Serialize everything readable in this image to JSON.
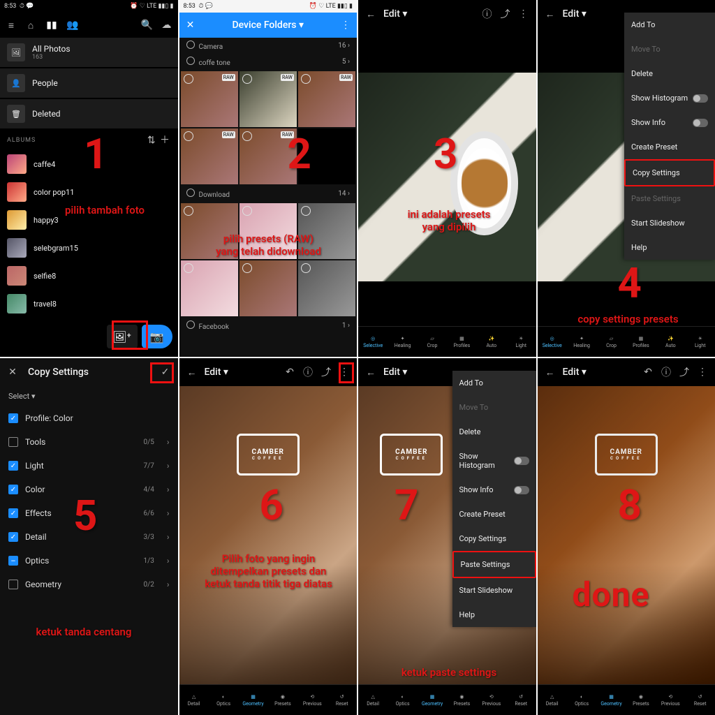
{
  "status": {
    "time": "8:53",
    "net": "LTE"
  },
  "panel1": {
    "all_photos": "All Photos",
    "all_photos_count": "163",
    "people": "People",
    "deleted": "Deleted",
    "albums_label": "ALBUMS",
    "albums": [
      {
        "name": "caffe",
        "count": "4"
      },
      {
        "name": "color pop",
        "count": "11"
      },
      {
        "name": "happy",
        "count": "3"
      },
      {
        "name": "selebgram",
        "count": "15"
      },
      {
        "name": "selfie",
        "count": "8"
      },
      {
        "name": "travel",
        "count": "8"
      }
    ],
    "anno_num": "1",
    "anno_text": "pilih tambah foto"
  },
  "panel2": {
    "title": "Device Folders",
    "folders": [
      {
        "name": "Camera",
        "count": "16"
      },
      {
        "name": "coffe tone",
        "count": "5"
      },
      {
        "name": "Download",
        "count": "14"
      },
      {
        "name": "Facebook",
        "count": "1"
      }
    ],
    "raw_badge": "RAW",
    "anno_num": "2",
    "anno_line1": "pilih presets (RAW)",
    "anno_line2": "yang telah didownload"
  },
  "panel3": {
    "edit": "Edit",
    "tools": [
      "Selective",
      "Healing",
      "Crop",
      "Profiles",
      "Auto",
      "Light"
    ],
    "anno_num": "3",
    "anno_line1": "ini adalah presets",
    "anno_line2": "yang dipilih"
  },
  "panel4": {
    "edit": "Edit",
    "menu": [
      {
        "t": "Add To",
        "d": false
      },
      {
        "t": "Move To",
        "d": true
      },
      {
        "t": "Delete",
        "d": false
      },
      {
        "t": "Show Histogram",
        "d": false,
        "toggle": true
      },
      {
        "t": "Show Info",
        "d": false,
        "toggle": true
      },
      {
        "t": "Create Preset",
        "d": false
      },
      {
        "t": "Copy Settings",
        "d": false,
        "hl": true
      },
      {
        "t": "Paste Settings",
        "d": true
      },
      {
        "t": "Start Slideshow",
        "d": false
      },
      {
        "t": "Help",
        "d": false
      }
    ],
    "tools": [
      "Selective",
      "Healing",
      "Crop",
      "Profiles",
      "Auto",
      "Light"
    ],
    "anno_num": "4",
    "anno_text": "copy settings presets"
  },
  "panel5": {
    "title": "Copy Settings",
    "select_label": "Select",
    "rows": [
      {
        "name": "Profile: Color",
        "chk": "checked",
        "count": ""
      },
      {
        "name": "Tools",
        "chk": "",
        "count": "0/5"
      },
      {
        "name": "Light",
        "chk": "checked",
        "count": "7/7"
      },
      {
        "name": "Color",
        "chk": "checked",
        "count": "4/4"
      },
      {
        "name": "Effects",
        "chk": "checked",
        "count": "6/6"
      },
      {
        "name": "Detail",
        "chk": "checked",
        "count": "3/3"
      },
      {
        "name": "Optics",
        "chk": "partial",
        "count": "1/3"
      },
      {
        "name": "Geometry",
        "chk": "",
        "count": "0/2"
      }
    ],
    "anno_num": "5",
    "anno_text": "ketuk tanda centang"
  },
  "panel6": {
    "edit": "Edit",
    "tools": [
      "Detail",
      "Optics",
      "Geometry",
      "Presets",
      "Previous",
      "Reset"
    ],
    "logo_main": "CAMBER",
    "logo_sub": "COFFEE",
    "anno_num": "6",
    "anno_l1": "Pilih foto yang ingin",
    "anno_l2": "ditempelkan presets dan",
    "anno_l3": "ketuk tanda titik tiga diatas"
  },
  "panel7": {
    "edit": "Edit",
    "menu": [
      {
        "t": "Add To",
        "d": false
      },
      {
        "t": "Move To",
        "d": true
      },
      {
        "t": "Delete",
        "d": false
      },
      {
        "t": "Show Histogram",
        "d": false,
        "toggle": true
      },
      {
        "t": "Show Info",
        "d": false,
        "toggle": true
      },
      {
        "t": "Create Preset",
        "d": false
      },
      {
        "t": "Copy Settings",
        "d": false
      },
      {
        "t": "Paste Settings",
        "d": false,
        "hl": true
      },
      {
        "t": "Start Slideshow",
        "d": false
      },
      {
        "t": "Help",
        "d": false
      }
    ],
    "tools": [
      "Detail",
      "Optics",
      "Geometry",
      "Presets",
      "Previous",
      "Reset"
    ],
    "logo_main": "CAMBER",
    "logo_sub": "COFFEE",
    "anno_num": "7",
    "anno_text": "ketuk paste settings"
  },
  "panel8": {
    "edit": "Edit",
    "tools": [
      "Detail",
      "Optics",
      "Geometry",
      "Presets",
      "Previous",
      "Reset"
    ],
    "logo_main": "CAMBER",
    "logo_sub": "COFFEE",
    "anno_num": "8",
    "anno_text": "done"
  }
}
